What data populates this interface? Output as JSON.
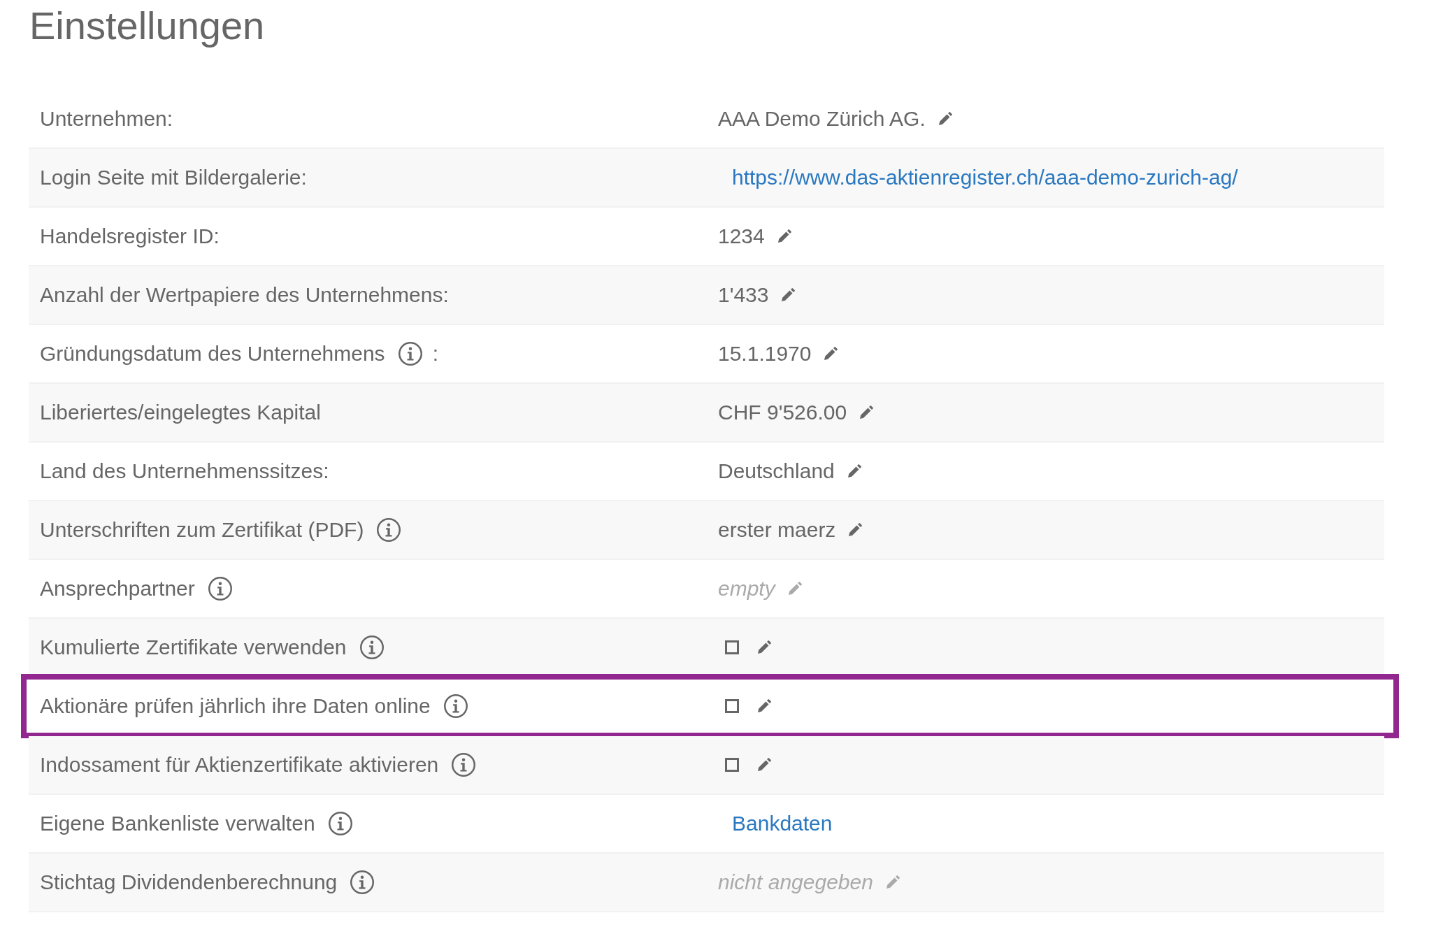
{
  "title": "Einstellungen",
  "rows": [
    {
      "label": "Unternehmen:",
      "info": false,
      "kind": "text",
      "value": "AAA Demo Zürich AG.",
      "muted": false,
      "editable": true,
      "highlighted": false
    },
    {
      "label": "Login Seite mit Bildergalerie:",
      "info": false,
      "kind": "link",
      "value": "https://www.das-aktienregister.ch/aaa-demo-zurich-ag/",
      "editable": false,
      "highlighted": false
    },
    {
      "label": "Handelsregister ID:",
      "info": false,
      "kind": "text",
      "value": "1234",
      "muted": false,
      "editable": true,
      "highlighted": false
    },
    {
      "label": "Anzahl der Wertpapiere des Unternehmens:",
      "info": false,
      "kind": "text",
      "value": "1'433",
      "muted": false,
      "editable": true,
      "highlighted": false
    },
    {
      "label": "Gründungsdatum des Unternehmens",
      "info": true,
      "suffix": ":",
      "kind": "text",
      "value": "15.1.1970",
      "muted": false,
      "editable": true,
      "highlighted": false
    },
    {
      "label": "Liberiertes/eingelegtes Kapital",
      "info": false,
      "kind": "text",
      "value": "CHF 9'526.00",
      "muted": false,
      "editable": true,
      "highlighted": false
    },
    {
      "label": "Land des Unternehmenssitzes:",
      "info": false,
      "kind": "text",
      "value": "Deutschland",
      "muted": false,
      "editable": true,
      "highlighted": false
    },
    {
      "label": "Unterschriften zum Zertifikat (PDF)",
      "info": true,
      "kind": "text",
      "value": "erster maerz",
      "muted": false,
      "editable": true,
      "highlighted": false
    },
    {
      "label": "Ansprechpartner",
      "info": true,
      "kind": "text",
      "value": "empty",
      "muted": true,
      "editable": true,
      "highlighted": false
    },
    {
      "label": "Kumulierte Zertifikate verwenden",
      "info": true,
      "kind": "checkbox",
      "checked": false,
      "editable": true,
      "highlighted": false
    },
    {
      "label": "Aktionäre prüfen jährlich ihre Daten online",
      "info": true,
      "kind": "checkbox",
      "checked": false,
      "editable": true,
      "highlighted": true
    },
    {
      "label": "Indossament für Aktienzertifikate aktivieren",
      "info": true,
      "kind": "checkbox",
      "checked": false,
      "editable": true,
      "highlighted": false
    },
    {
      "label": "Eigene Bankenliste verwalten",
      "info": true,
      "kind": "link",
      "value": "Bankdaten",
      "editable": false,
      "highlighted": false
    },
    {
      "label": "Stichtag Dividendenberechnung",
      "info": true,
      "kind": "text",
      "value": "nicht angegeben",
      "muted": true,
      "editable": true,
      "highlighted": false
    }
  ]
}
